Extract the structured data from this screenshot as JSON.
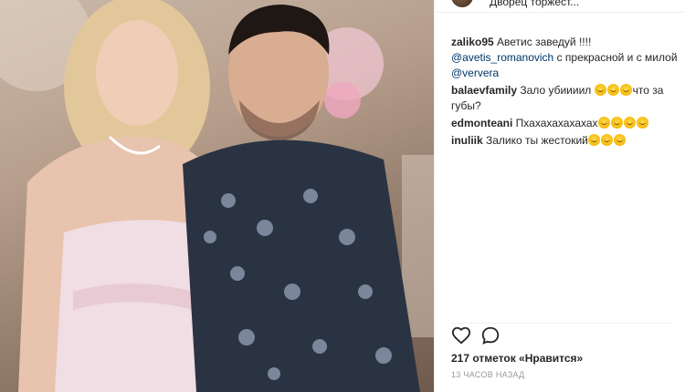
{
  "post": {
    "location": "Дворец торжест...",
    "photo_alt": "",
    "likes": "217 отметок «Нравится»",
    "timestamp": "13 ЧАСОВ НАЗАД"
  },
  "comments": [
    {
      "user": "zaliko95",
      "parts": [
        {
          "t": " Аветис заведуй !!!! "
        },
        {
          "t": "@avetis_romanovich",
          "link": true
        },
        {
          "t": " с прекрасной и с милой "
        },
        {
          "t": "@ververa",
          "link": true
        }
      ],
      "emoji": 0
    },
    {
      "user": "balaevfamily",
      "parts": [
        {
          "t": " Зало убиииил "
        }
      ],
      "emoji": 3,
      "after": "что за губы?"
    },
    {
      "user": "edmonteani",
      "parts": [
        {
          "t": " Пхахахахахахах"
        }
      ],
      "emoji": 4
    },
    {
      "user": "inuliik",
      "parts": [
        {
          "t": " Залико ты жестокий"
        }
      ],
      "emoji": 3
    }
  ],
  "icons": {
    "like": "heart-icon",
    "comment": "speech-bubble-icon",
    "emoji": "laughing-emoji-icon"
  },
  "colors": {
    "link": "#003569",
    "follow": "#3897f0",
    "muted": "#999999"
  }
}
